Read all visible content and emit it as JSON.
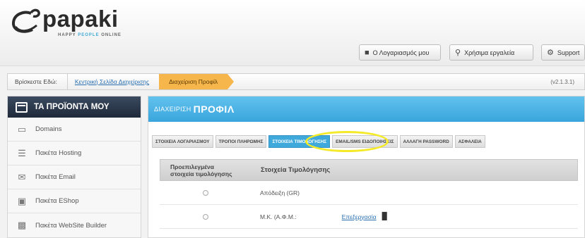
{
  "header": {
    "logo_text": "papaki",
    "logo_tagline_a": "HAPPY ",
    "logo_tagline_b": "PEOPLE",
    "logo_tagline_c": " ONLINE",
    "buttons": [
      {
        "label": "Ο Λογαριασμός μου",
        "icon": "user-icon"
      },
      {
        "label": "Χρήσιμα εργαλεία",
        "icon": "wrench-icon"
      },
      {
        "label": "Support",
        "icon": "gear-icon"
      }
    ]
  },
  "breadcrumb": {
    "prefix": "Βρίσκεστε Εδώ:",
    "link": "Κεντρική Σελίδα Διαχείρισης",
    "active": "Διαχείριση Προφίλ",
    "version": "(v2.1.3.1)"
  },
  "sidebar": {
    "title": "ΤΑ ΠΡΟΪΟΝΤΑ ΜΟΥ",
    "items": [
      {
        "label": "Domains",
        "icon": "monitor-icon"
      },
      {
        "label": "Πακέτα Hosting",
        "icon": "server-icon"
      },
      {
        "label": "Πακέτα Email",
        "icon": "envelope-icon"
      },
      {
        "label": "Πακέτα EShop",
        "icon": "cart-icon"
      },
      {
        "label": "Πακέτα WebSite Builder",
        "icon": "builder-icon"
      }
    ]
  },
  "main": {
    "title_prefix": "ΔΙΑΧΕΙΡΙΣΗ",
    "title_main": "ΠΡΟΦΙΛ",
    "tabs": [
      {
        "label": "ΣΤΟΙΧΕΙΑ ΛΟΓΑΡΙΑΣΜΟΥ",
        "active": false
      },
      {
        "label": "ΤΡΟΠΟΙ ΠΛΗΡΩΜΗΣ",
        "active": false
      },
      {
        "label": "ΣΤΟΙΧΕΙΑ ΤΙΜΟΛΟΓΗΣΗΣ",
        "active": true
      },
      {
        "label": "EMAIL/SMS ΕΙΔΟΠΟΙΗΣΕΙΣ",
        "active": false
      },
      {
        "label": "ΑΛΛΑΓΗ PASSWORD",
        "active": false
      },
      {
        "label": "ΑΣΦΑΛΕΙΑ",
        "active": false
      }
    ],
    "table": {
      "col1_line1": "Προεπιλεγμένα",
      "col1_line2": "στοιχεία τιμολόγησης",
      "col2": "Στοιχεία Τιμολόγησης",
      "rows": [
        {
          "text": "Απόδειξη (GR)",
          "edit": ""
        },
        {
          "text": "Μ.Κ. (Α.Φ.Μ.:",
          "edit": "Επεξεργασία"
        }
      ]
    }
  },
  "colors": {
    "header_blue": "#39a5dc",
    "sidebar_dark": "#1f2a3a",
    "breadcrumb_active": "#f6b64b",
    "highlight_ring": "#f4ea2a"
  }
}
